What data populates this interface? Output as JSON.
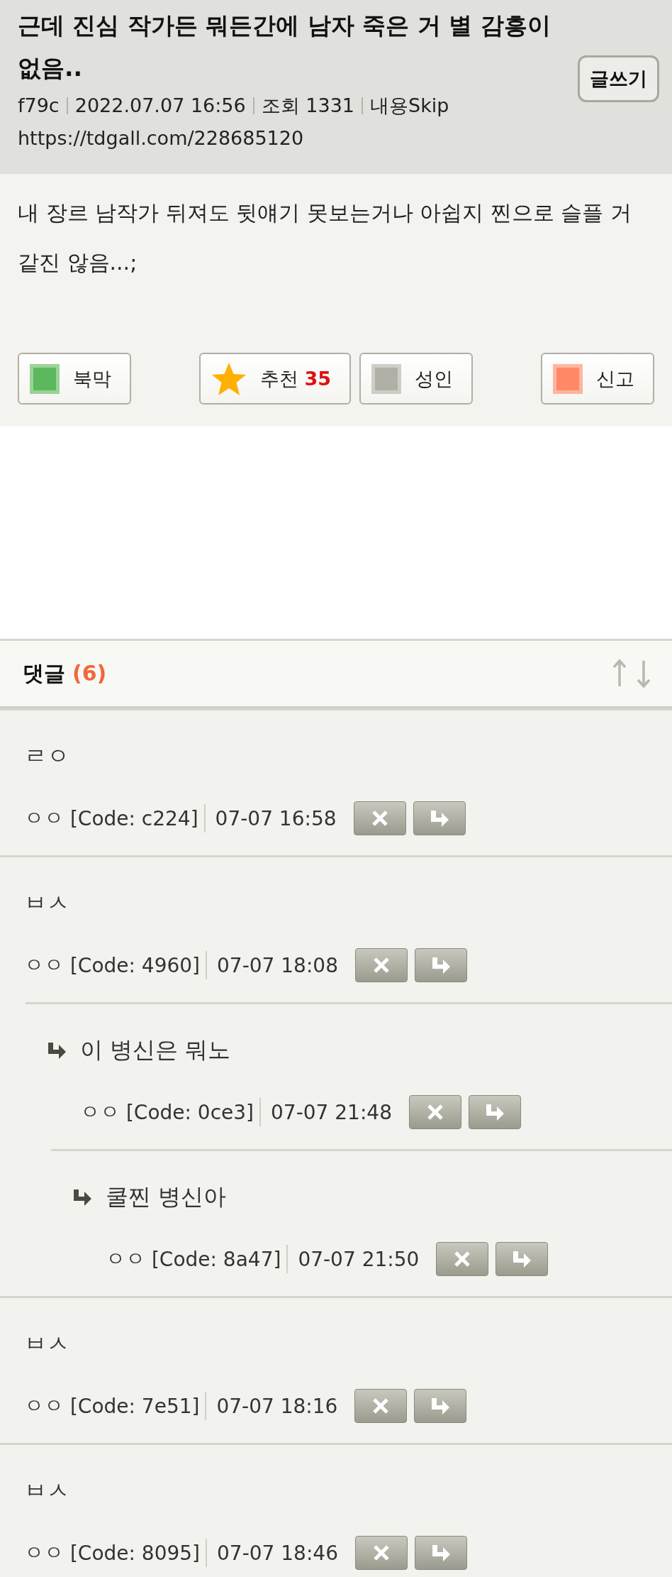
{
  "post": {
    "title": "근데 진심 작가든 뭐든간에 남자 죽은 거 별 감흥이 없음..",
    "write_button": "글쓰기",
    "meta": [
      "f79c",
      "2022.07.07 16:56",
      "조회 1331",
      "내용Skip"
    ],
    "url": "https://tdgall.com/228685120",
    "body": "내 장르 남작가 뒤져도 뒷얘기 못보는거나 아쉽지 찐으로 슬플 거 같진 않음...;",
    "actions": [
      {
        "kind": "bookmark",
        "label": "북막"
      },
      {
        "kind": "recommend",
        "label": "추천",
        "count": "35"
      },
      {
        "kind": "adult",
        "label": "성인"
      },
      {
        "kind": "report",
        "label": "신고"
      }
    ]
  },
  "comments_header": {
    "title": "댓글",
    "count": "(6)"
  },
  "comments": [
    {
      "text": "ㄹㅇ",
      "author": "ㅇㅇ",
      "code": "[Code: c224]",
      "time": "07-07 16:58"
    },
    {
      "text": "ㅂㅅ",
      "author": "ㅇㅇ",
      "code": "[Code: 4960]",
      "time": "07-07 18:08",
      "children": [
        {
          "text": "이 병신은 뭐노",
          "author": "ㅇㅇ",
          "code": "[Code: 0ce3]",
          "time": "07-07 21:48",
          "children": [
            {
              "text": "쿨찐 병신아",
              "author": "ㅇㅇ",
              "code": "[Code: 8a47]",
              "time": "07-07 21:50"
            }
          ]
        }
      ]
    },
    {
      "text": "ㅂㅅ",
      "author": "ㅇㅇ",
      "code": "[Code: 7e51]",
      "time": "07-07 18:16"
    },
    {
      "text": "ㅂㅅ",
      "author": "ㅇㅇ",
      "code": "[Code: 8095]",
      "time": "07-07 18:46"
    }
  ]
}
